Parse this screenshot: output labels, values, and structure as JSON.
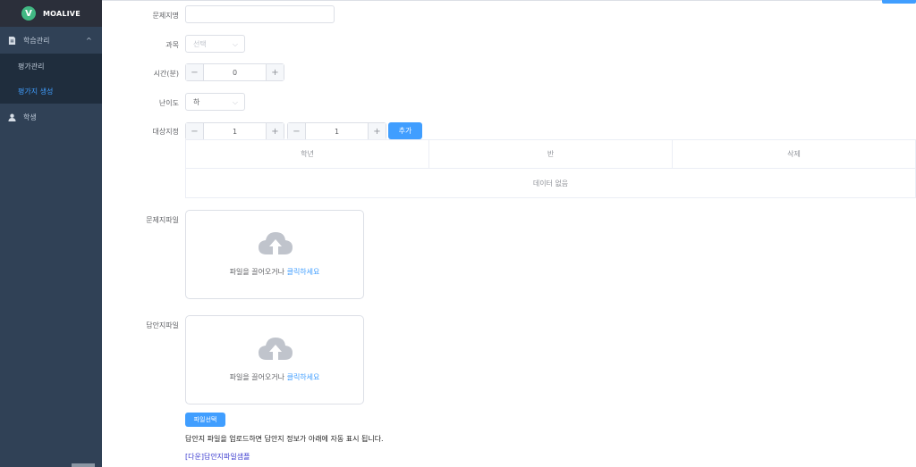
{
  "brand": {
    "logo_letter": "V",
    "name": "MOALIVE",
    "logo_color": "#41b883"
  },
  "sidebar": {
    "group_learning": {
      "label": "학습관리",
      "chevron": "^"
    },
    "items": [
      {
        "label": "평가관리"
      },
      {
        "label": "평가지 생성"
      }
    ],
    "group_student": {
      "label": "학생"
    }
  },
  "form": {
    "title": {
      "label": "문제지명",
      "value": ""
    },
    "subject": {
      "label": "과목",
      "placeholder": "선택"
    },
    "time": {
      "label": "시간(분)",
      "value": "0",
      "minus": "−",
      "plus": "+"
    },
    "difficulty": {
      "label": "난이도",
      "value": "하"
    },
    "target": {
      "label": "대상지정",
      "grade_value": "1",
      "class_value": "1",
      "minus": "−",
      "plus": "+",
      "add_label": "추가"
    },
    "table": {
      "columns": [
        "학년",
        "반",
        "삭제"
      ],
      "empty_text": "데이터 없음"
    },
    "question_file": {
      "label": "문제지파일",
      "text": "파일을 끌어오거나",
      "click_text": "클릭하세요"
    },
    "answer_file": {
      "label": "답안지파일",
      "text": "파일을 끌어오거나",
      "click_text": "클릭하세요"
    },
    "file_select_label": "파일선택",
    "note": "답안지 파일을 업로드하면 답안지 정보가 아래에 자동 표시 됩니다.",
    "sample_link": "[다운]답안지파일샘플"
  },
  "colors": {
    "primary": "#409eff",
    "sidebar_bg": "#304156",
    "submenu_bg": "#1f2d3d",
    "logo_bar": "#2b2f3a"
  }
}
